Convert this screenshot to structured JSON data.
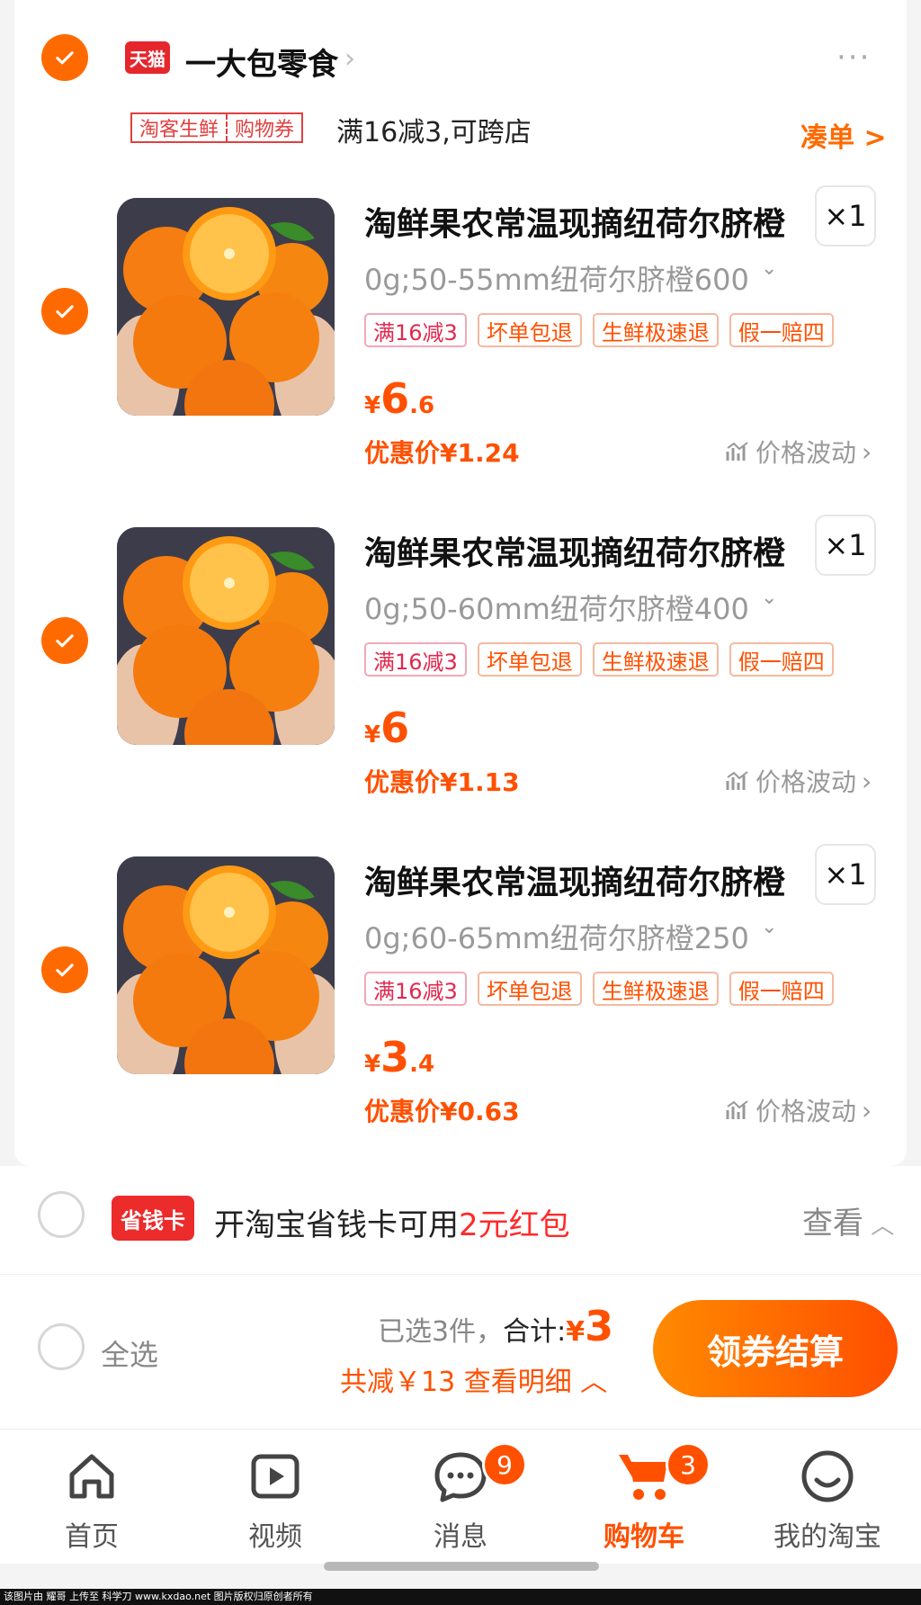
{
  "shop": {
    "logo": "天猫",
    "name": "一大包零食",
    "promo_tags": [
      "淘客生鲜",
      "购物券"
    ],
    "promo_text": "满16减3,可跨店",
    "make_order": "凑单 >"
  },
  "items": [
    {
      "title": "淘鲜果农常温现摘纽荷尔脐橙",
      "qty": "×1",
      "sku": "0g;50-55mm纽荷尔脐橙600",
      "tags": [
        "满16减3",
        "坏单包退",
        "生鲜极速退",
        "假一赔四"
      ],
      "price_yen": "¥",
      "price_int": "6",
      "price_dec": ".6",
      "discount": "优惠价¥1.24",
      "trend": "价格波动"
    },
    {
      "title": "淘鲜果农常温现摘纽荷尔脐橙",
      "qty": "×1",
      "sku": "0g;50-60mm纽荷尔脐橙400",
      "tags": [
        "满16减3",
        "坏单包退",
        "生鲜极速退",
        "假一赔四"
      ],
      "price_yen": "¥",
      "price_int": "6",
      "price_dec": "",
      "discount": "优惠价¥1.13",
      "trend": "价格波动"
    },
    {
      "title": "淘鲜果农常温现摘纽荷尔脐橙",
      "qty": "×1",
      "sku": "0g;60-65mm纽荷尔脐橙250",
      "tags": [
        "满16减3",
        "坏单包退",
        "生鲜极速退",
        "假一赔四"
      ],
      "price_yen": "¥",
      "price_int": "3",
      "price_dec": ".4",
      "discount": "优惠价¥0.63",
      "trend": "价格波动"
    }
  ],
  "saver": {
    "logo": "省钱卡",
    "text_prefix": "开淘宝省钱卡可用",
    "text_red": "2元红包",
    "view": "查看"
  },
  "checkout": {
    "select_all": "全选",
    "selected": "已选3件，",
    "total_label": "合计:",
    "total_yen": "¥",
    "total_value": "3",
    "reduce": "共减￥13  查看明细",
    "pay_button": "领券结算"
  },
  "tabs": [
    {
      "label": "首页",
      "icon": "home-icon"
    },
    {
      "label": "视频",
      "icon": "video-icon"
    },
    {
      "label": "消息",
      "icon": "message-icon",
      "badge": "9"
    },
    {
      "label": "购物车",
      "icon": "cart-icon",
      "badge": "3"
    },
    {
      "label": "我的淘宝",
      "icon": "profile-icon"
    }
  ],
  "footer_watermark": "该图片由 耀哥 上传至 科学刀 www.kxdao.net 图片版权归原创者所有",
  "colors": {
    "accent": "#ff5000",
    "check": "#ff6a00",
    "tmall": "#e5262d"
  }
}
